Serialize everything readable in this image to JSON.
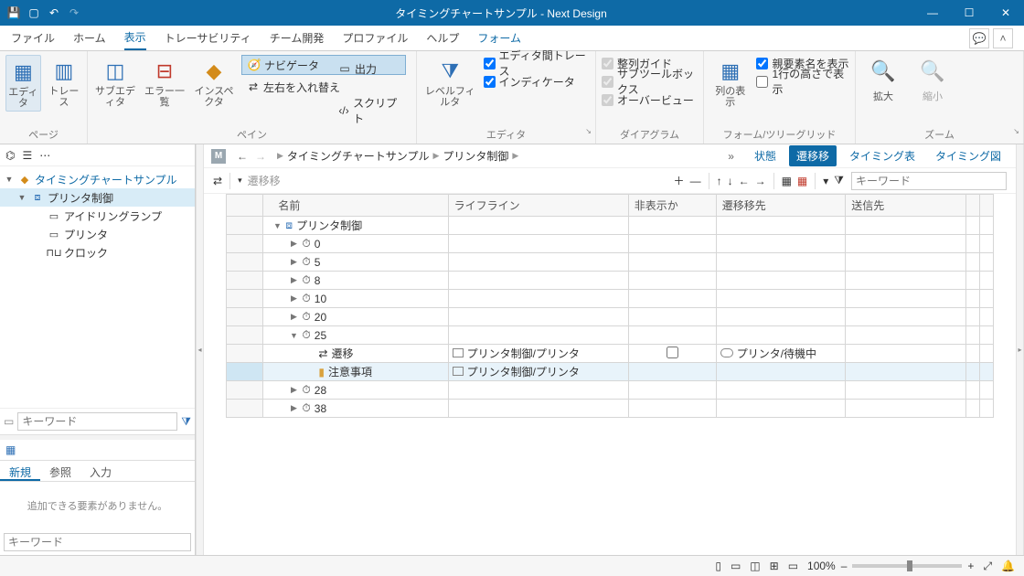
{
  "title": "タイミングチャートサンプル - Next Design",
  "menus": [
    "ファイル",
    "ホーム",
    "表示",
    "トレーサビリティ",
    "チーム開発",
    "プロファイル",
    "ヘルプ",
    "フォーム"
  ],
  "ribbon": {
    "page": {
      "label": "ページ",
      "editor": "エディタ",
      "trace": "トレース"
    },
    "pane": {
      "label": "ペイン",
      "subeditor": "サブエディタ",
      "errorlist": "エラー一覧",
      "inspector": "インスペクタ",
      "navigator": "ナビゲータ",
      "output": "出力",
      "swap": "左右を入れ替え",
      "script": "スクリプト"
    },
    "editor": {
      "label": "エディタ",
      "levelfilter": "レベルフィルタ",
      "cross": "エディタ間トレース",
      "indicator": "インディケータ"
    },
    "diagram": {
      "label": "ダイアグラム",
      "align": "整列ガイド",
      "subtool": "サブツールボックス",
      "overview": "オーバービュー"
    },
    "formtree": {
      "label": "フォーム/ツリーグリッド",
      "colshow": "列の表示",
      "parentname": "親要素名を表示",
      "oneline": "1行の高さで表示"
    },
    "zoom": {
      "label": "ズーム",
      "zoomin": "拡大",
      "zoomout": "縮小"
    }
  },
  "tree": {
    "root": "タイミングチャートサンプル",
    "printer": "プリンタ制御",
    "idling": "アイドリングランプ",
    "printer2": "プリンタ",
    "clock": "クロック"
  },
  "leftsearch": {
    "placeholder": "キーワード"
  },
  "lefttabs": [
    "新規",
    "参照",
    "入力"
  ],
  "leftmsg": "追加できる要素がありません。",
  "leftkw": "キーワード",
  "breadcrumb": {
    "m": "M",
    "root": "タイミングチャートサンプル",
    "printer": "プリンタ制御"
  },
  "viewbtns": {
    "state": "状態",
    "transition": "遷移移",
    "timing": "タイミング表",
    "tchart": "タイミング図"
  },
  "gridtool": {
    "transition": "遷移移",
    "kw": "キーワード"
  },
  "columns": [
    "名前",
    "ライフライン",
    "非表示か",
    "遷移移先",
    "送信先"
  ],
  "rows": [
    {
      "indent": 0,
      "arrow": "▼",
      "icon": "pctrl",
      "name": "プリンタ制御"
    },
    {
      "indent": 1,
      "arrow": "▶",
      "icon": "clock",
      "name": "0"
    },
    {
      "indent": 1,
      "arrow": "▶",
      "icon": "clock",
      "name": "5"
    },
    {
      "indent": 1,
      "arrow": "▶",
      "icon": "clock",
      "name": "8"
    },
    {
      "indent": 1,
      "arrow": "▶",
      "icon": "clock",
      "name": "10"
    },
    {
      "indent": 1,
      "arrow": "▶",
      "icon": "clock",
      "name": "20"
    },
    {
      "indent": 1,
      "arrow": "▼",
      "icon": "clock",
      "name": "25"
    },
    {
      "indent": 2,
      "arrow": "",
      "icon": "trans",
      "name": "遷移",
      "lifeline": "プリンタ制御/プリンタ",
      "hide": true,
      "dest": "プリンタ/待機中"
    },
    {
      "indent": 2,
      "arrow": "",
      "icon": "note",
      "name": "注意事項",
      "lifeline": "プリンタ制御/プリンタ",
      "sel": true
    },
    {
      "indent": 1,
      "arrow": "▶",
      "icon": "clock",
      "name": "28"
    },
    {
      "indent": 1,
      "arrow": "▶",
      "icon": "clock",
      "name": "38"
    }
  ],
  "statusbar": {
    "zoom": "100%"
  }
}
